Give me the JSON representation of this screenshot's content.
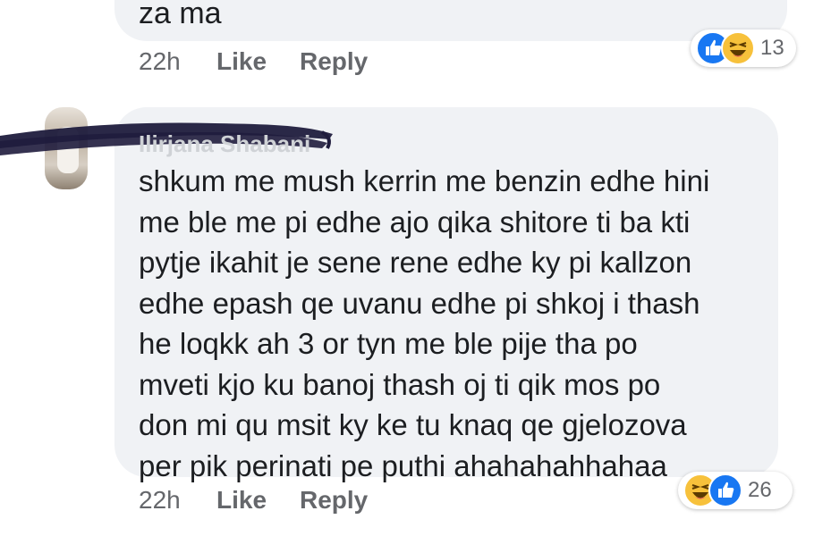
{
  "previous_comment": {
    "text_tail": "za ma",
    "time": "22h",
    "like_label": "Like",
    "reply_label": "Reply",
    "reactions": {
      "icons": [
        "like-icon",
        "haha-icon"
      ],
      "count": "13"
    }
  },
  "comment": {
    "author": "Ilirjana Shabani",
    "body": "shkum me mush kerrin me benzin edhe hini\nme ble me pi edhe ajo qika shitore ti ba kti\npytje ikahit je sene rene edhe ky pi kallzon\nedhe epash qe uvanu edhe pi shkoj i thash\nhe loqkk ah 3 or tyn me ble pije   tha po\nmveti kjo ku banoj thash oj ti qik mos po\ndon mi qu msit ky ke tu knaq qe gjelozova\nper pik perinati pe puthi ahahahahhahaa",
    "time": "22h",
    "like_label": "Like",
    "reply_label": "Reply",
    "reactions": {
      "icons": [
        "haha-icon",
        "like-icon"
      ],
      "count": "26"
    }
  },
  "colors": {
    "bubble": "#f0f2f5",
    "meta_text": "#65676b",
    "like_blue": "#1877f2",
    "haha_yellow": "#f7c13b",
    "redaction_ink": "#1f1c3d"
  }
}
